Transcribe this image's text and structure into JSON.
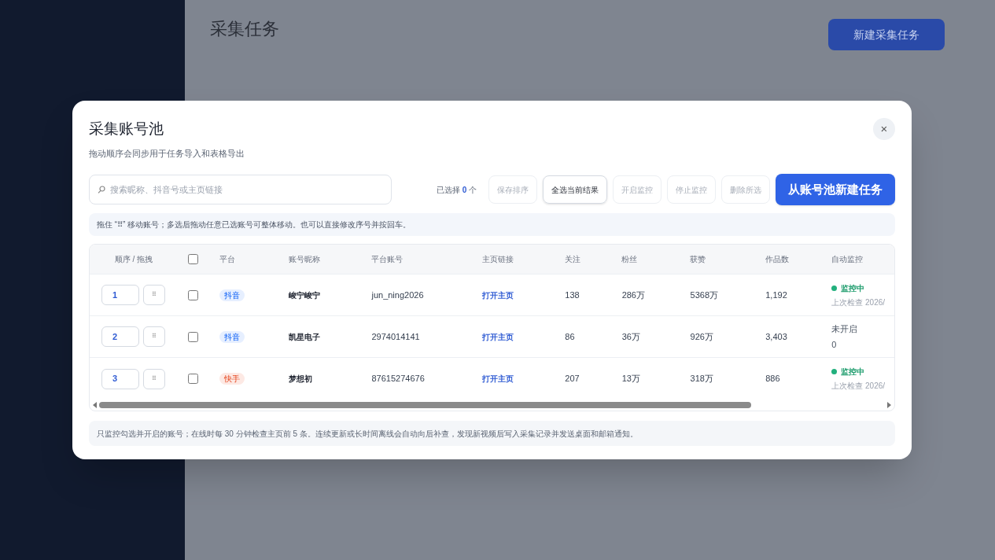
{
  "page": {
    "title": "采集任务",
    "primary_button": "新建采集任务"
  },
  "dialog": {
    "title": "采集账号池",
    "subtitle": "拖动顺序会同步用于任务导入和表格导出",
    "close": "×",
    "search": {
      "placeholder": "搜索昵称、抖音号或主页链接"
    },
    "selection": {
      "prefix": "已选择",
      "count": "0",
      "suffix": "个"
    },
    "actions": [
      {
        "label": "保存排序",
        "disabled": true
      },
      {
        "label": "全选当前结果",
        "disabled": false
      },
      {
        "label": "开启监控",
        "disabled": true
      },
      {
        "label": "停止监控",
        "disabled": true
      },
      {
        "label": "删除所选",
        "disabled": true
      }
    ],
    "create_button": "从账号池新建任务",
    "hint": "拖住 “⠿” 移动账号；多选后拖动任意已选账号可整体移动。也可以直接修改序号并按回车。",
    "columns": [
      "顺序 / 拖拽",
      "平台",
      "账号昵称",
      "平台账号",
      "主页链接",
      "关注",
      "粉丝",
      "获赞",
      "作品数",
      "自动监控"
    ],
    "header_checked": false,
    "rows": [
      {
        "order": "1",
        "handle": "⠿",
        "checked": false,
        "platform": "抖音",
        "color": "#e6efff",
        "nickname": "峻宁峻宁",
        "account": "jun_ning2026",
        "link": "打开主页",
        "following": "138",
        "fans": "286万",
        "likes": "5368万",
        "works": "1,192",
        "monitor": {
          "kind": "on",
          "status": "监控中",
          "detail": "上次检查 2026/"
        }
      },
      {
        "order": "2",
        "handle": "⠿",
        "checked": false,
        "platform": "抖音",
        "color": "#e6efff",
        "nickname": "凯星电子",
        "account": "2974014141",
        "link": "打开主页",
        "following": "86",
        "fans": "36万",
        "likes": "926万",
        "works": "3,403",
        "monitor": {
          "kind": "off",
          "status": "未开启",
          "detail": "0"
        }
      },
      {
        "order": "3",
        "handle": "⠿",
        "checked": false,
        "platform": "快手",
        "color": "#fde9e4",
        "nickname": "梦想初",
        "account": "87615274676",
        "link": "打开主页",
        "following": "207",
        "fans": "13万",
        "likes": "318万",
        "works": "886",
        "monitor": {
          "kind": "on",
          "status": "监控中",
          "detail": "上次检查 2026/"
        }
      }
    ],
    "footer": "只监控勾选并开启的账号；在线时每 30 分钟检查主页前 5 条。连续更新或长时间离线会自动向后补查，发现新视频后写入采集记录并发送桌面和邮箱通知。"
  }
}
